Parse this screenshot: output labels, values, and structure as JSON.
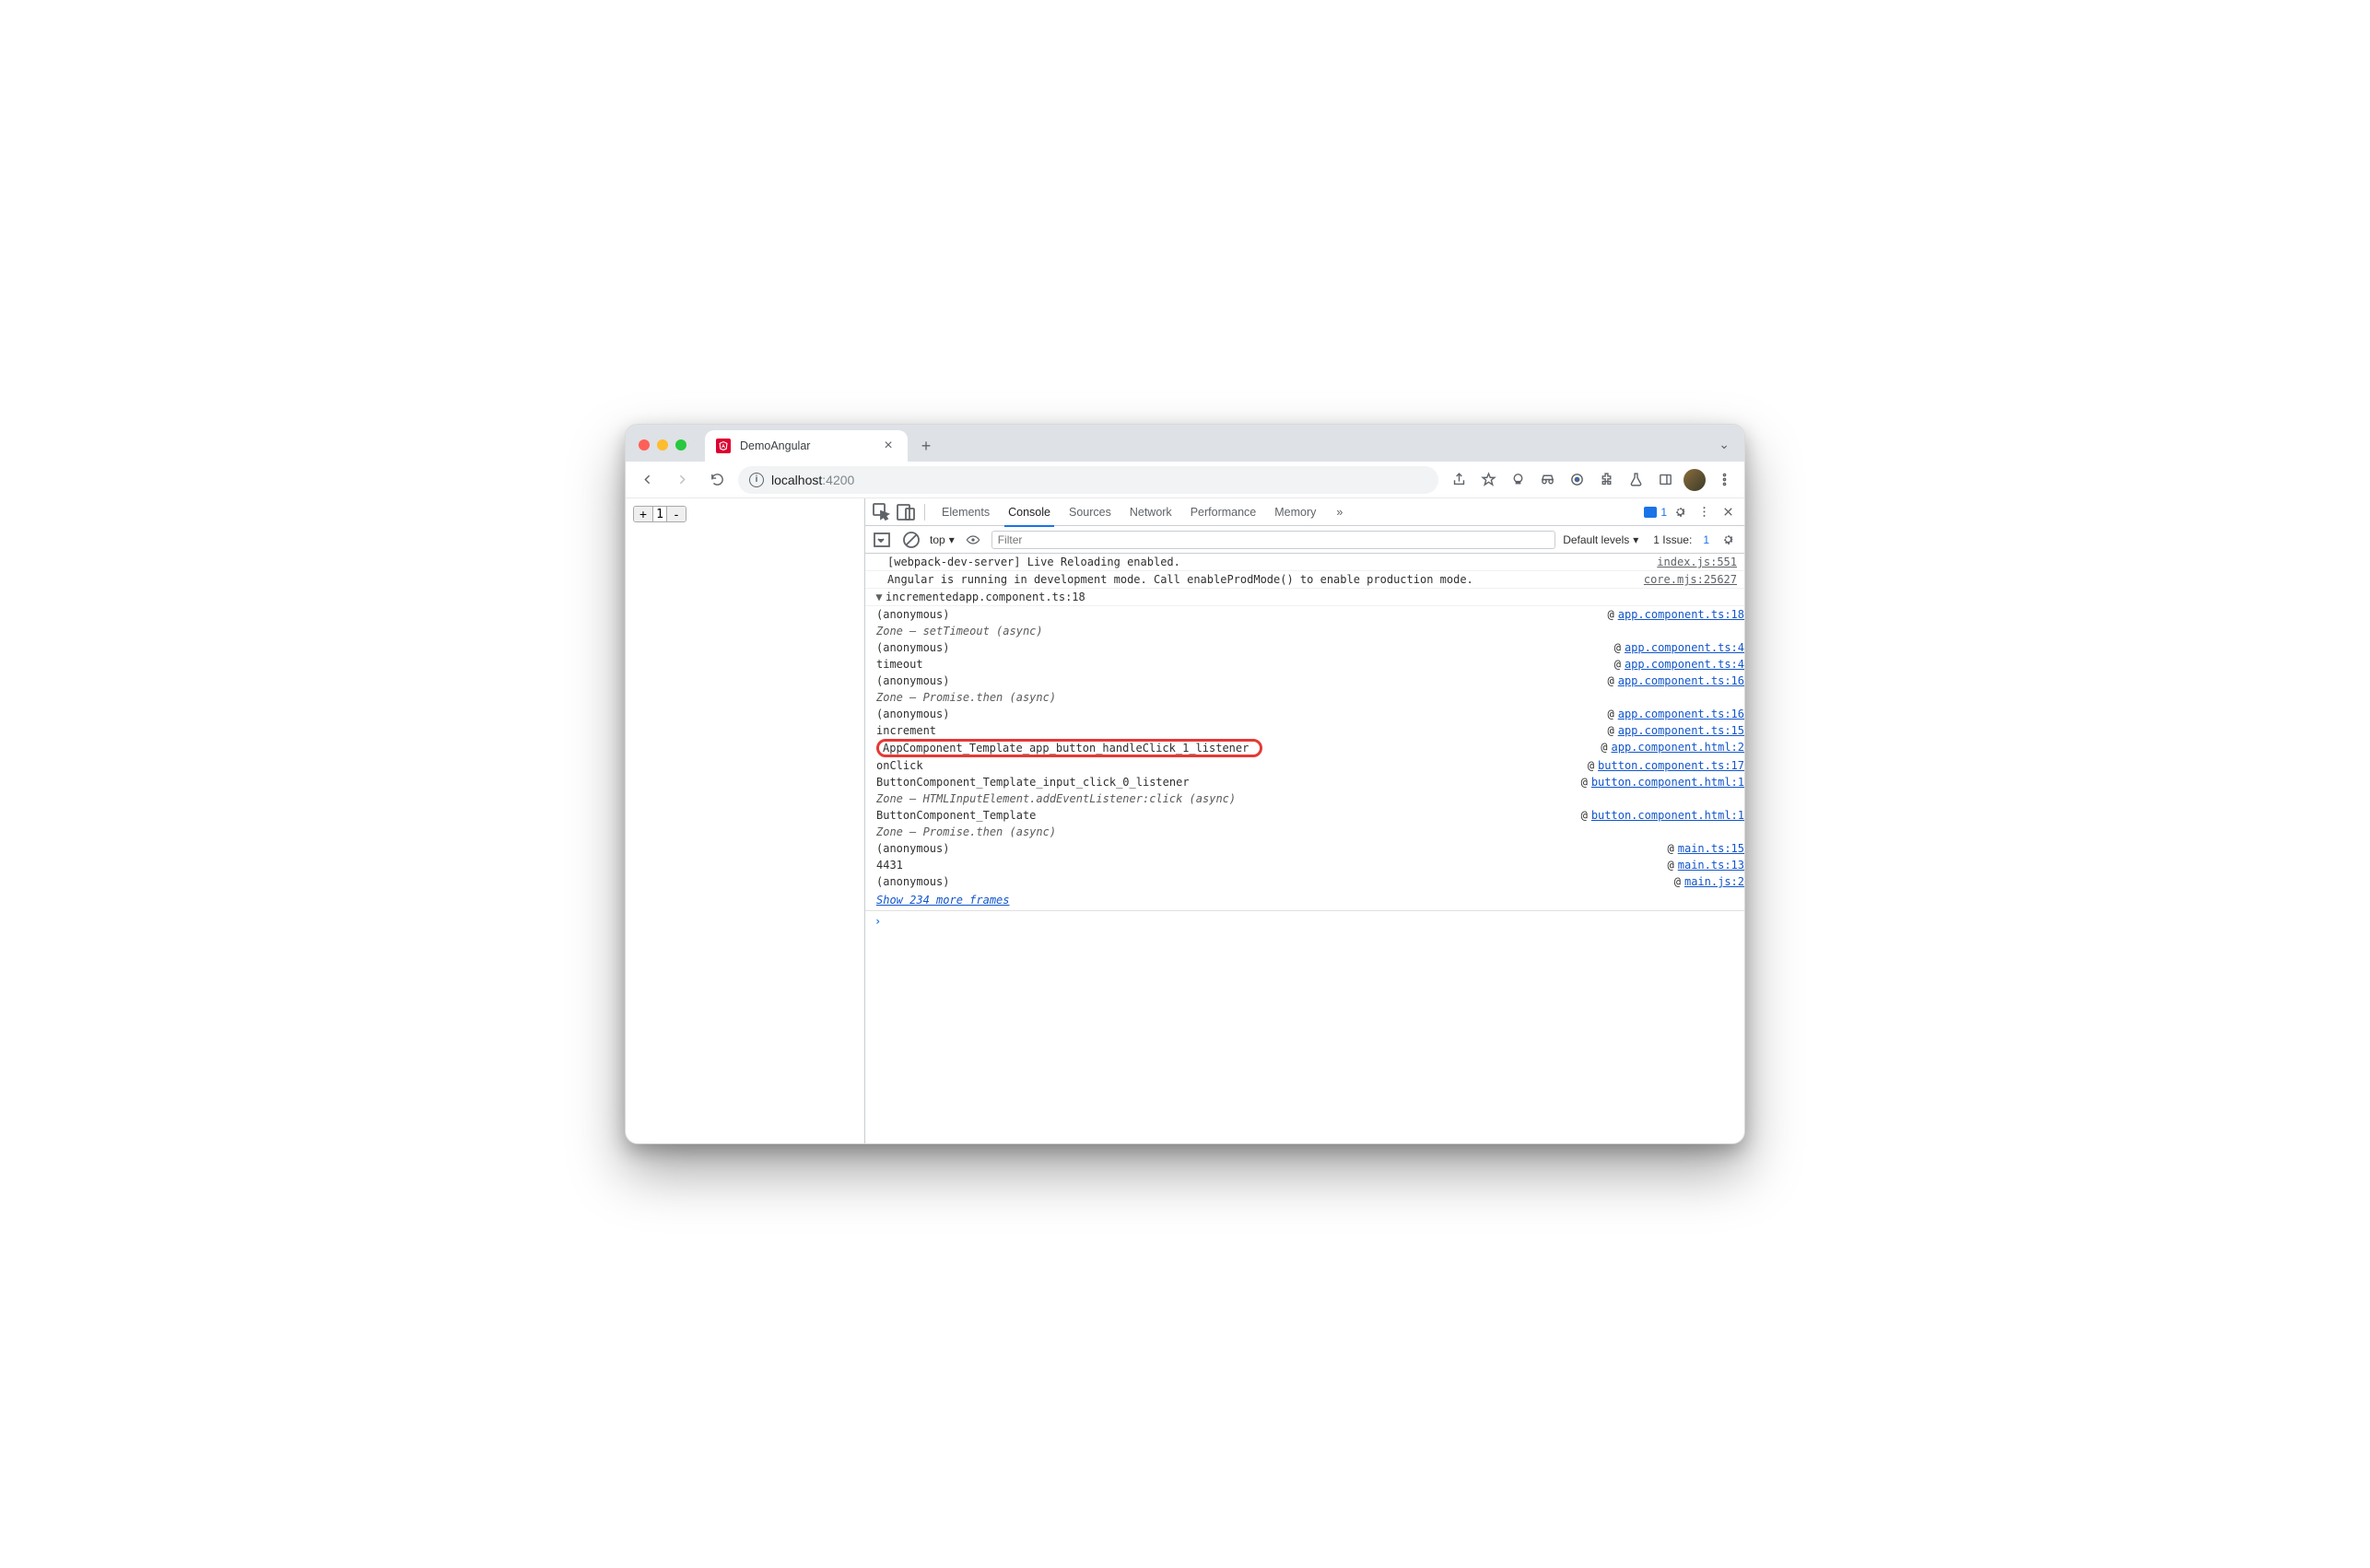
{
  "browser": {
    "tab_title": "DemoAngular",
    "url_host": "localhost",
    "url_path": ":4200"
  },
  "page": {
    "counter_value": "1"
  },
  "devtools": {
    "tabs": [
      "Elements",
      "Console",
      "Sources",
      "Network",
      "Performance",
      "Memory"
    ],
    "active_tab": "Console",
    "more_glyph": "»",
    "message_count": "1",
    "console": {
      "context": "top",
      "filter_placeholder": "Filter",
      "levels": "Default levels",
      "issues_label": "1 Issue:",
      "issues_count": "1"
    }
  },
  "logs": [
    {
      "msg": "[webpack-dev-server] Live Reloading enabled.",
      "src": "index.js:551",
      "link": false
    },
    {
      "msg": "Angular is running in development mode. Call enableProdMode() to enable production mode.",
      "src": "core.mjs:25627",
      "link": false
    }
  ],
  "trace": {
    "label": "incremented",
    "head_src": "app.component.ts:18",
    "stack": [
      {
        "fn": "(anonymous)",
        "loc": "app.component.ts:18",
        "at": "@"
      },
      {
        "fn": "Zone — setTimeout (async)",
        "italic": true
      },
      {
        "fn": "(anonymous)",
        "loc": "app.component.ts:4",
        "at": "@"
      },
      {
        "fn": "timeout",
        "loc": "app.component.ts:4",
        "at": "@"
      },
      {
        "fn": "(anonymous)",
        "loc": "app.component.ts:16",
        "at": "@"
      },
      {
        "fn": "Zone — Promise.then (async)",
        "italic": true
      },
      {
        "fn": "(anonymous)",
        "loc": "app.component.ts:16",
        "at": "@"
      },
      {
        "fn": "increment",
        "loc": "app.component.ts:15",
        "at": "@"
      },
      {
        "fn": "AppComponent_Template_app_button_handleClick_1_listener",
        "loc": "app.component.html:2",
        "at": "@",
        "highlight": true
      },
      {
        "fn": "onClick",
        "loc": "button.component.ts:17",
        "at": "@"
      },
      {
        "fn": "ButtonComponent_Template_input_click_0_listener",
        "loc": "button.component.html:1",
        "at": "@"
      },
      {
        "fn": "Zone — HTMLInputElement.addEventListener:click (async)",
        "italic": true
      },
      {
        "fn": "ButtonComponent_Template",
        "loc": "button.component.html:1",
        "at": "@"
      },
      {
        "fn": "Zone — Promise.then (async)",
        "italic": true
      },
      {
        "fn": "(anonymous)",
        "loc": "main.ts:15",
        "at": "@"
      },
      {
        "fn": "4431",
        "loc": "main.ts:13",
        "at": "@"
      },
      {
        "fn": "(anonymous)",
        "loc": "main.js:2",
        "at": "@"
      }
    ],
    "show_more": "Show 234 more frames"
  }
}
